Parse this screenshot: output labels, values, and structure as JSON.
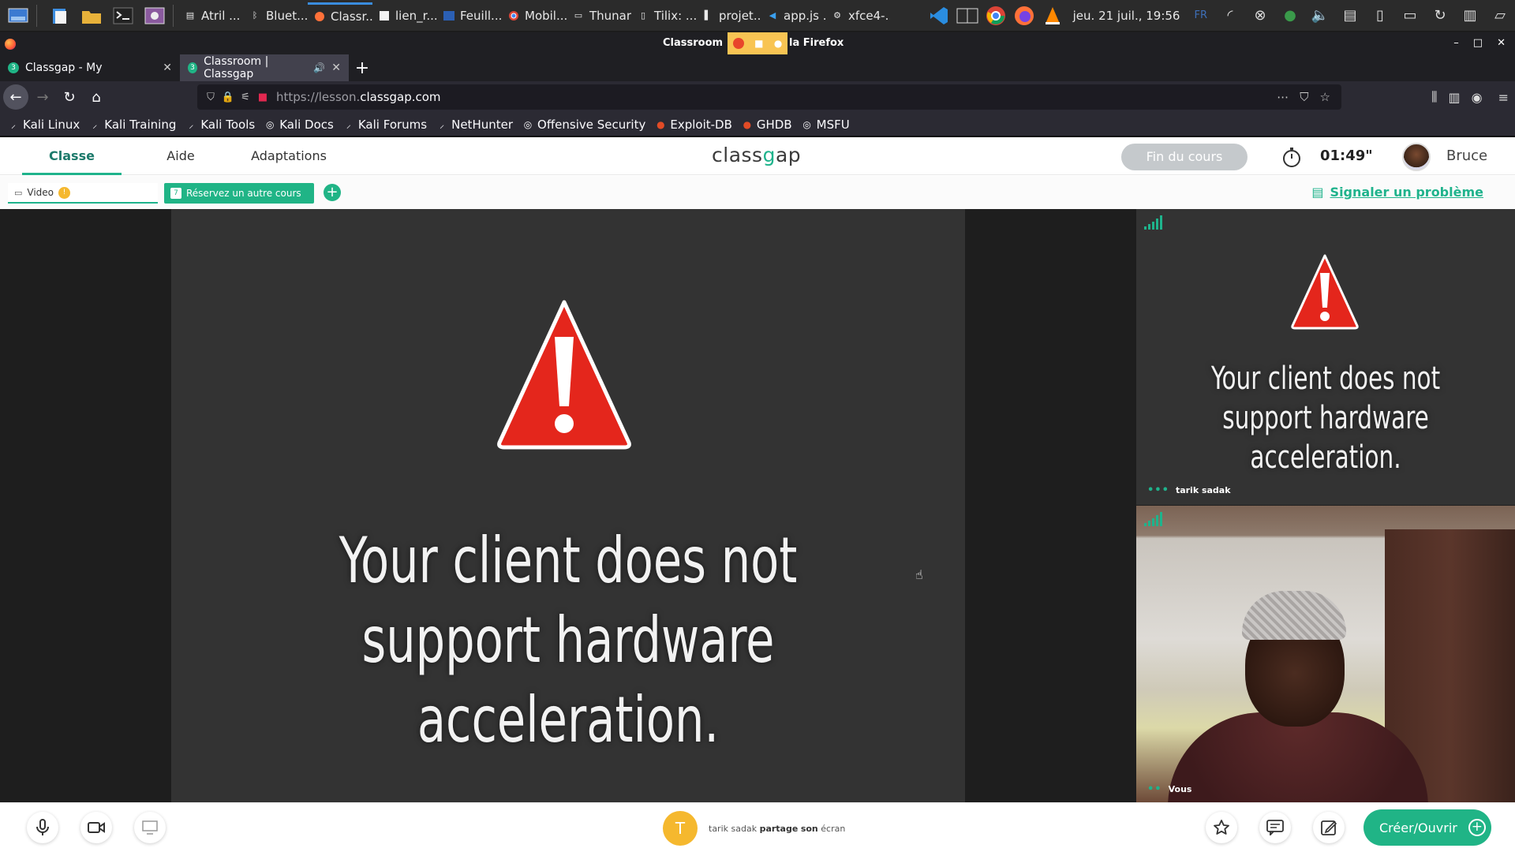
{
  "taskbar": {
    "windows": [
      {
        "label": "Atril ...",
        "icon": "document-viewer-icon"
      },
      {
        "label": "Bluet...",
        "icon": "bluetooth-icon"
      },
      {
        "label": "Classr...",
        "icon": "firefox-icon",
        "active": true
      },
      {
        "label": "lien_r...",
        "icon": "text-editor-icon"
      },
      {
        "label": "Feuill...",
        "icon": "word-icon"
      },
      {
        "label": "Mobil...",
        "icon": "chrome-icon"
      },
      {
        "label": "Thunar",
        "icon": "file-manager-icon"
      },
      {
        "label": "Tilix: ...",
        "icon": "terminal-icon"
      },
      {
        "label": "projet...",
        "icon": "file-icon"
      },
      {
        "label": "app.js ...",
        "icon": "vscode-icon"
      },
      {
        "label": "xfce4-...",
        "icon": "settings-icon"
      }
    ],
    "clock": "jeu. 21 juil., 19:56",
    "lang": "FR"
  },
  "firefox": {
    "title": "Classroom | Cl — Mozilla Firefox",
    "title_left": "Classroom | Cl",
    "title_right": "la Firefox",
    "tabs": [
      {
        "label": "Classgap - My",
        "badge": "3"
      },
      {
        "label": "Classroom | Classgap",
        "badge": "3",
        "active": true
      }
    ],
    "url_dim": "https://lesson.",
    "url_host": "classgap.com",
    "bookmarks": [
      "Kali Linux",
      "Kali Training",
      "Kali Tools",
      "Kali Docs",
      "Kali Forums",
      "NetHunter",
      "Offensive Security",
      "Exploit-DB",
      "GHDB",
      "MSFU"
    ]
  },
  "classgap": {
    "nav": {
      "classe": "Classe",
      "aide": "Aide",
      "adaptations": "Adaptations"
    },
    "brand_a": "class",
    "brand_g": "g",
    "brand_b": "ap",
    "end_button": "Fin du cours",
    "timer": "01:49\"",
    "user": "Bruce",
    "video_tab": "Video",
    "video_badge": "!",
    "book_button": "Réservez un autre cours",
    "book_date": "7",
    "report_link": "Signaler un problème",
    "shared_message": "Your client does not support hardware acceleration.",
    "remote_message": "Your client does not support hardware acceleration.",
    "remote_name": "tarik sadak",
    "self_name": "Vous",
    "share_avatar": "T",
    "share_who": "tarik sadak",
    "share_verb": "partage",
    "share_mid": "son",
    "share_what": "écran",
    "create_button": "Créer/Ouvrir",
    "colors": {
      "accent": "#20b486",
      "warning": "#f5b82e",
      "end_button": "#c5c9cc"
    }
  }
}
